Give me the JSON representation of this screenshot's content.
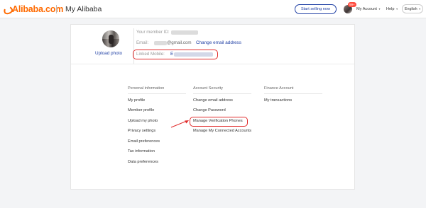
{
  "header": {
    "logo_text": "Alibaba.com",
    "section_title": "My Alibaba",
    "start_selling": "Start selling now",
    "notification_badge": "99+",
    "my_account": "My Account",
    "help": "Help",
    "language": "English",
    "caret": "▾"
  },
  "profile": {
    "upload_photo": "Upload photo",
    "member_id_label": "Your member ID:",
    "email_label": "Email:",
    "email_value_visible": "@gmail.com",
    "change_email": "Change email address",
    "mobile_label": "Linked Mobile:",
    "mobile_value_visible": "E"
  },
  "columns": [
    {
      "heading": "Personal information",
      "links": [
        "My profile",
        "Member profile",
        "Upload my photo",
        "Privacy settings",
        "Email preferences",
        "Tax information",
        "Data preferences"
      ]
    },
    {
      "heading": "Account Security",
      "links": [
        "Change email address",
        "Change Password",
        "Manage Verification Phones",
        "Manage My Connected Accounts"
      ]
    },
    {
      "heading": "Finance Account",
      "links": [
        "My transactions"
      ]
    }
  ],
  "colors": {
    "brand": "#ff6a00",
    "link": "#1f3fa4",
    "annotation": "#e12b2b"
  }
}
